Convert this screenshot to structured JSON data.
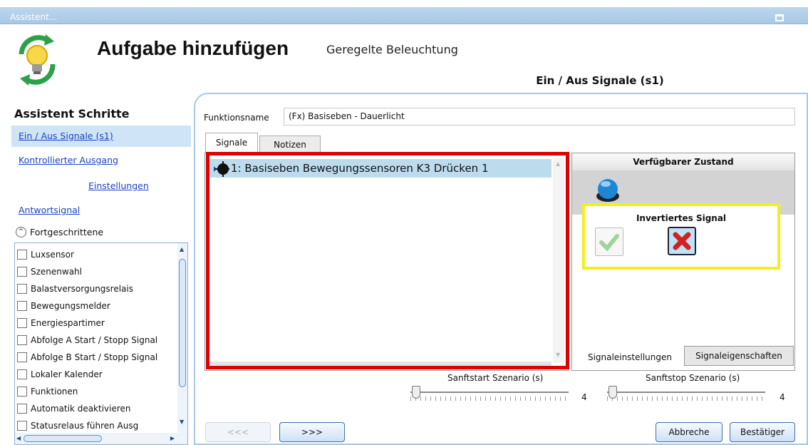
{
  "window": {
    "title": "Assistent..."
  },
  "header": {
    "title": "Aufgabe hinzufügen",
    "subtitle": "Geregelte Beleuchtung",
    "current_step": "Ein / Aus Signale (s1)"
  },
  "sidebar": {
    "heading": "Assistent Schritte",
    "steps": [
      {
        "label": "Ein / Aus Signale (s1)",
        "active": true
      },
      {
        "label": "Kontrollierter Ausgang",
        "active": false
      },
      {
        "label": "Einstellungen",
        "active": false
      },
      {
        "label": "Antwortsignal",
        "active": false
      }
    ],
    "advanced_label": "Fortgeschrittene",
    "advanced_items": [
      "Luxsensor",
      "Szenenwahl",
      "Balastversorgungsrelais",
      "Bewegungsmelder",
      "Energiespartimer",
      "Abfolge A Start / Stopp Signal",
      "Abfolge B Start / Stopp Signal",
      "Lokaler Kalender",
      "Funktionen",
      "Automatik deaktivieren",
      "Statusrelaus führen    Ausg"
    ]
  },
  "main": {
    "function_name_label": "Funktionsname",
    "function_name_value": "(Fx) Basiseben - Dauerlicht",
    "tabs": [
      {
        "label": "Signale",
        "selected": true
      },
      {
        "label": "Notizen",
        "selected": false
      }
    ],
    "signals": [
      "1: Basiseben Bewegungssensoren K3 Drücken 1"
    ],
    "state_panel": {
      "heading": "Verfügbarer Zustand",
      "inverted_heading": "Invertiertes Signal",
      "inverted_selected": "x",
      "tabs": [
        {
          "label": "Signaleinstellungen",
          "selected": true
        },
        {
          "label": "Signaleigenschaften",
          "selected": false
        }
      ]
    },
    "softstart": {
      "label": "Sanftstart Szenario (s)",
      "value": "4",
      "level": 0
    },
    "softstop": {
      "label": "Sanftstop Szenario (s)",
      "value": "4",
      "level": 0
    }
  },
  "footer": {
    "back_label": "<<<",
    "next_label": ">>>",
    "cancel_label": "Abbreche",
    "confirm_label": "Bestätiger"
  },
  "colors": {
    "highlight_red": "#e00000",
    "highlight_yellow": "#f1f116",
    "link_blue": "#1a44c6",
    "selection_blue": "#bcdcee"
  }
}
